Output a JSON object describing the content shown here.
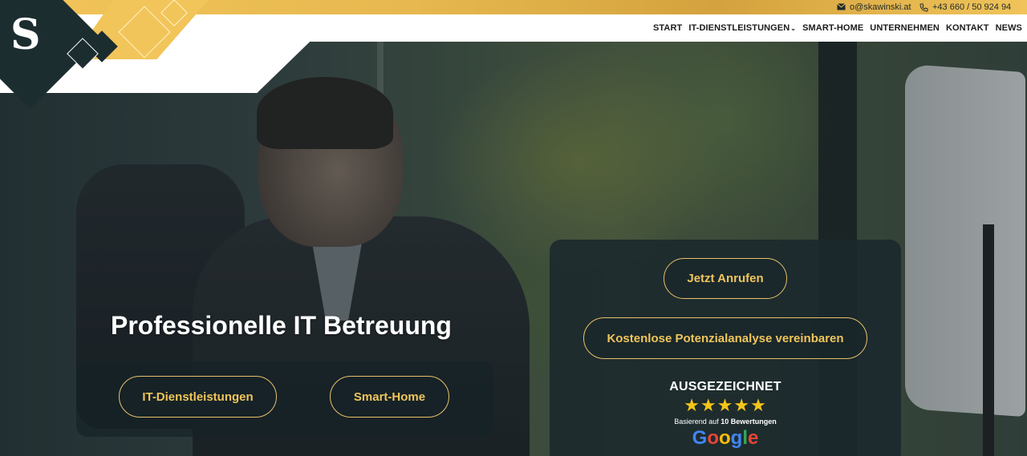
{
  "topbar": {
    "email": "o@skawinski.at",
    "phone": "+43 660 / 50 924 94",
    "email_icon": "envelope-icon",
    "phone_icon": "phone-icon"
  },
  "nav": {
    "items": [
      {
        "label": "START"
      },
      {
        "label": "IT-DIENSTLEISTUNGEN",
        "has_dropdown": true
      },
      {
        "label": "SMART-HOME"
      },
      {
        "label": "UNTERNEHMEN"
      },
      {
        "label": "KONTAKT"
      },
      {
        "label": "NEWS"
      }
    ]
  },
  "logo": {
    "letter": "S"
  },
  "hero": {
    "heading": "Professionelle IT Betreuung",
    "buttons": {
      "it_services": "IT-Dienstleistungen",
      "smart_home": "Smart-Home"
    }
  },
  "panel": {
    "call_button": "Jetzt Anrufen",
    "analysis_button": "Kostenlose Potenzialanalyse vereinbaren",
    "award_title": "AUSGEZEICHNET",
    "stars": "★★★★★",
    "rating": 5,
    "reviews_prefix": "Basierend auf",
    "reviews_count": "10 Bewertungen",
    "google_letters": [
      "G",
      "o",
      "o",
      "g",
      "l",
      "e"
    ]
  },
  "colors": {
    "accent_gold": "#f0c55b",
    "dark_teal": "#1c2d30",
    "google_blue": "#4285F4",
    "google_red": "#EA4335",
    "google_yellow": "#FBBC05",
    "google_green": "#34A853"
  }
}
